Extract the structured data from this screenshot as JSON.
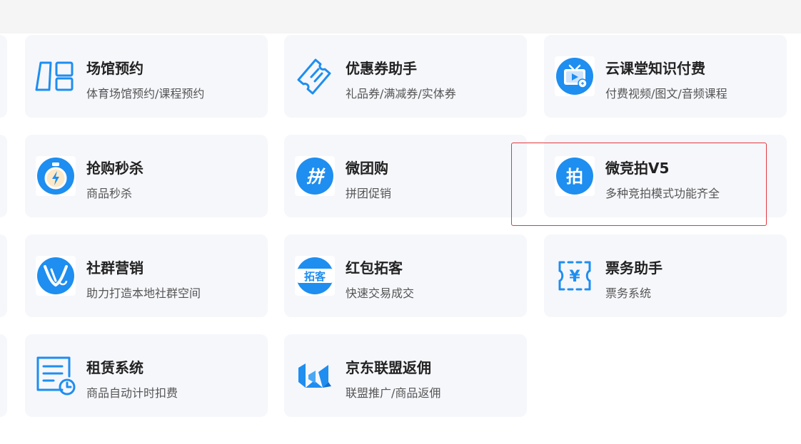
{
  "services": [
    {
      "key": "venue",
      "title": "场馆预约",
      "desc": "体育场馆预约/课程预约",
      "icon": "venue-booking-icon"
    },
    {
      "key": "coupon",
      "title": "优惠券助手",
      "desc": "礼品券/满减券/实体券",
      "icon": "coupon-ticket-icon"
    },
    {
      "key": "course",
      "title": "云课堂知识付费",
      "desc": "付费视频/图文/音频课程",
      "icon": "tv-video-course-icon"
    },
    {
      "key": "flashsale",
      "title": "抢购秒杀",
      "desc": "商品秒杀",
      "icon": "stopwatch-lightning-icon"
    },
    {
      "key": "groupbuy",
      "title": "微团购",
      "desc": "拼团促销",
      "icon": "group-buy-pin-icon",
      "glyph": "拼"
    },
    {
      "key": "auction",
      "title": "微竞拍V5",
      "desc": "多种竞拍模式功能齐全",
      "icon": "auction-pai-icon",
      "glyph": "拍"
    },
    {
      "key": "community",
      "title": "社群营销",
      "desc": "助力打造本地社群空间",
      "icon": "community-marketing-icon"
    },
    {
      "key": "redpacket",
      "title": "红包拓客",
      "desc": "快速交易成交",
      "icon": "red-packet-tuoke-icon",
      "glyph": "拓客"
    },
    {
      "key": "ticket",
      "title": "票务助手",
      "desc": "票务系统",
      "icon": "yen-ticket-icon",
      "glyph": "¥"
    },
    {
      "key": "rental",
      "title": "租赁系统",
      "desc": "商品自动计时扣费",
      "icon": "document-clock-icon"
    },
    {
      "key": "jd",
      "title": "京东联盟返佣",
      "desc": "联盟推广/商品返佣",
      "icon": "jd-union-logo-icon"
    }
  ],
  "colors": {
    "accent": "#1e8ef0",
    "card_bg": "#f6f7fb",
    "highlight": "#e0393e"
  }
}
